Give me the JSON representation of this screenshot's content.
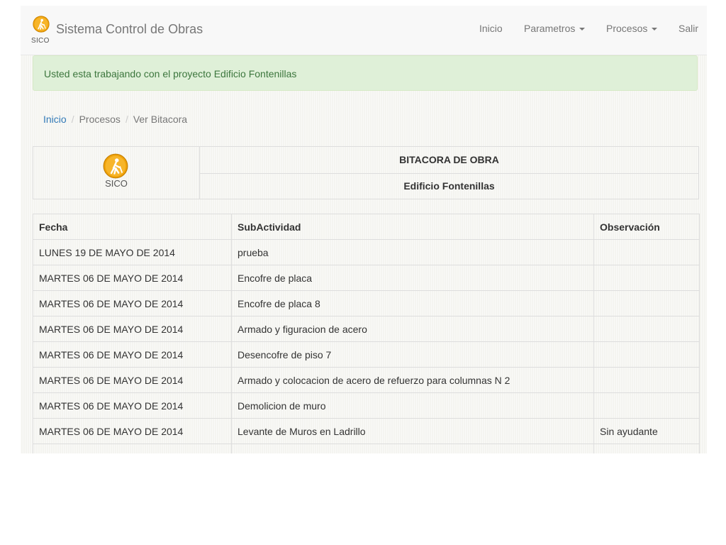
{
  "navbar": {
    "brand_title": "Sistema Control de Obras",
    "brand_short": "SICO",
    "links": {
      "inicio": "Inicio",
      "parametros": "Parametros",
      "procesos": "Procesos",
      "salir": "Salir"
    },
    "logo_icon": "construction-worker-icon",
    "accent_color": "#f0a30a"
  },
  "alert": {
    "text": "Usted esta trabajando con el proyecto Edificio Fontenillas",
    "color": "#dff0d8"
  },
  "breadcrumb": [
    "Inicio",
    "Procesos",
    "Ver Bitacora"
  ],
  "header": {
    "logo_label": "SICO",
    "title": "BITACORA DE OBRA",
    "project": "Edificio Fontenillas"
  },
  "table": {
    "columns": [
      "Fecha",
      "SubActividad",
      "Observación"
    ],
    "rows": [
      [
        "LUNES 19 DE MAYO DE 2014",
        "prueba",
        ""
      ],
      [
        "MARTES 06 DE MAYO DE 2014",
        "Encofre de placa",
        ""
      ],
      [
        "MARTES 06 DE MAYO DE 2014",
        "Encofre de placa 8",
        ""
      ],
      [
        "MARTES 06 DE MAYO DE 2014",
        "Armado y figuracion de acero",
        ""
      ],
      [
        "MARTES 06 DE MAYO DE 2014",
        "Desencofre de piso 7",
        ""
      ],
      [
        "MARTES 06 DE MAYO DE 2014",
        "Armado y colocacion de acero de refuerzo para columnas N 2",
        ""
      ],
      [
        "MARTES 06 DE MAYO DE 2014",
        "Demolicion de muro",
        ""
      ],
      [
        "MARTES 06 DE MAYO DE 2014",
        "Levante de Muros en Ladrillo",
        "Sin ayudante"
      ],
      [
        "",
        "",
        ""
      ]
    ]
  }
}
